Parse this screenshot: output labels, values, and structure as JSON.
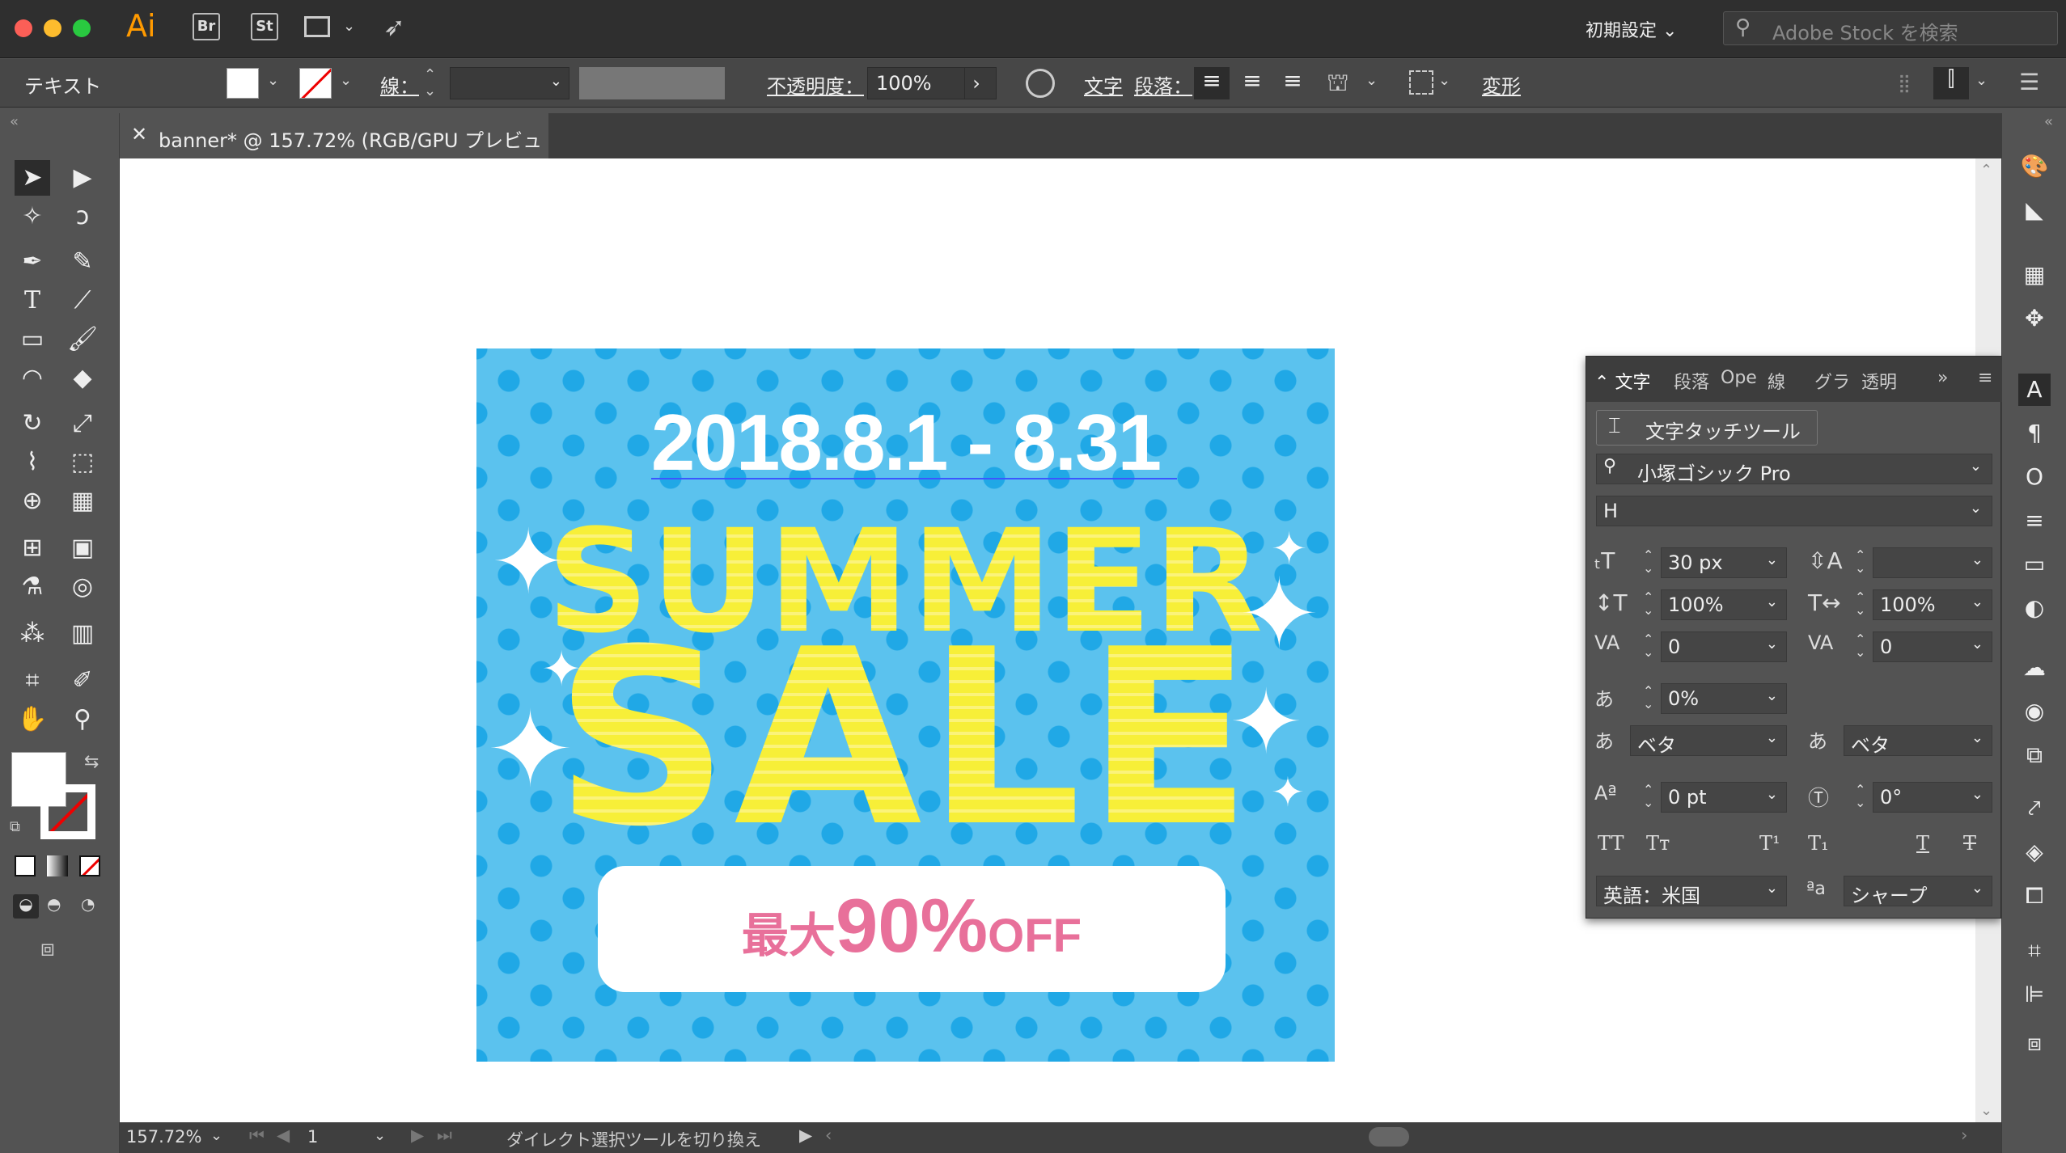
{
  "app": {
    "logo": "Ai",
    "bridge": "Br",
    "stock": "St",
    "workspace": "初期設定",
    "search_placeholder": "Adobe Stock を検索"
  },
  "control": {
    "mode": "テキスト",
    "stroke_label": "線：",
    "opacity_label": "不透明度：",
    "opacity_value": "100%",
    "char_label": "文字",
    "para_label": "段落：",
    "transform_label": "変形"
  },
  "document": {
    "tab_title": "banner* @ 157.72% (RGB/GPU プレビュー)"
  },
  "banner": {
    "dates": "2018.8.1 - 8.31",
    "line1": "SUMMER",
    "line2": "SALE",
    "off_prefix": "最大",
    "off_number": "90%",
    "off_suffix": "OFF"
  },
  "charpanel": {
    "tabs": [
      "文字",
      "段落",
      "Ope",
      "線",
      "グラ",
      "透明"
    ],
    "touch_tool": "文字タッチツール",
    "font_family": "小塚ゴシック Pro",
    "font_style": "H",
    "size": "30 px",
    "leading": "",
    "vscale": "100%",
    "hscale": "100%",
    "kerning": "0",
    "tracking": "0",
    "tsume": "0%",
    "aki_left": "ベタ",
    "aki_right": "ベタ",
    "baseline": "0 pt",
    "rotation": "0°",
    "language": "英語：米国",
    "antialias": "シャープ"
  },
  "status": {
    "zoom": "157.72%",
    "page": "1",
    "message": "ダイレクト選択ツールを切り換え"
  },
  "colors": {
    "banner_bg": "#5bc2ee",
    "dots": "#20a8e6",
    "yellow": "#f7ef38",
    "pink": "#e8709a",
    "ai_orange": "#ff9a00"
  }
}
